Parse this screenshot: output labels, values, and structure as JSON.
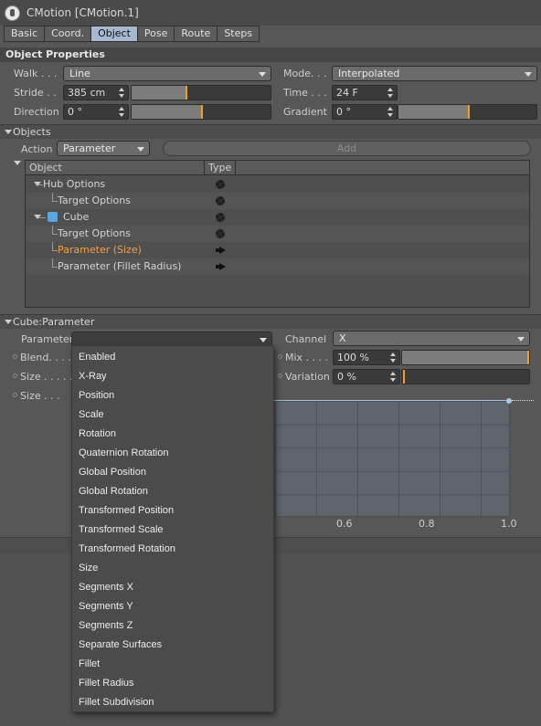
{
  "window": {
    "title": "CMotion [CMotion.1]"
  },
  "tabs": [
    "Basic",
    "Coord.",
    "Object",
    "Pose",
    "Route",
    "Steps"
  ],
  "active_tab": "Object",
  "object_properties": {
    "header": "Object Properties",
    "walk": {
      "label": "Walk . . .",
      "value": "Line"
    },
    "mode": {
      "label": "Mode. . .",
      "value": "Interpolated"
    },
    "stride": {
      "label": "Stride . .",
      "value": "385 cm",
      "slider_fraction": 0.38
    },
    "time": {
      "label": "Time . . .",
      "value": "24 F"
    },
    "direction": {
      "label": "Direction",
      "value": "0 °",
      "slider_fraction": 0.5
    },
    "gradient": {
      "label": "Gradient",
      "value": "0 °",
      "slider_fraction": 0.5
    }
  },
  "objects": {
    "header": "Objects",
    "action_label": "Action",
    "action_value": "Parameter",
    "add_label": "Add",
    "columns": [
      "Object",
      "Type"
    ],
    "rows": [
      {
        "label": "Hub Options",
        "type_icon": "gear-icon"
      },
      {
        "label": "Target Options",
        "type_icon": "gear-icon"
      },
      {
        "label": "Cube",
        "type_icon": "gear-icon"
      },
      {
        "label": "Target Options",
        "type_icon": "gear-icon"
      },
      {
        "label": "Parameter (Size)",
        "type_icon": "arrow-right-icon",
        "selected": true
      },
      {
        "label": "Parameter (Fillet Radius)",
        "type_icon": "arrow-right-icon"
      }
    ]
  },
  "cube_parameter": {
    "header": "Cube:Parameter",
    "parameter_label": "Parameter",
    "parameter_value": "",
    "channel_label": "Channel",
    "channel_value": "X",
    "blend_label": "Blend. . . .",
    "size1_label": "Size . . . . .",
    "size2_label": "Size . . .",
    "mix_label": "Mix . . . .",
    "mix_value": "100 %",
    "mix_fraction": 1.0,
    "variation_label": "Variation",
    "variation_value": "0 %",
    "variation_fraction": 0.0,
    "graph_ticks": [
      "0.6",
      "0.8",
      "1.0"
    ]
  },
  "popup_menu": {
    "items": [
      "Enabled",
      "X-Ray",
      "Position",
      "Scale",
      "Rotation",
      "Quaternion Rotation",
      "Global Position",
      "Global Rotation",
      "Transformed Position",
      "Transformed Scale",
      "Transformed Rotation",
      "Size",
      "Segments X",
      "Segments Y",
      "Segments Z",
      "Separate Surfaces",
      "Fillet",
      "Fillet Radius",
      "Fillet Subdivision"
    ]
  },
  "colors": {
    "accent": "#f0a020",
    "active_tab": "#a7b9d0",
    "selected_row_text": "#f0a040"
  }
}
